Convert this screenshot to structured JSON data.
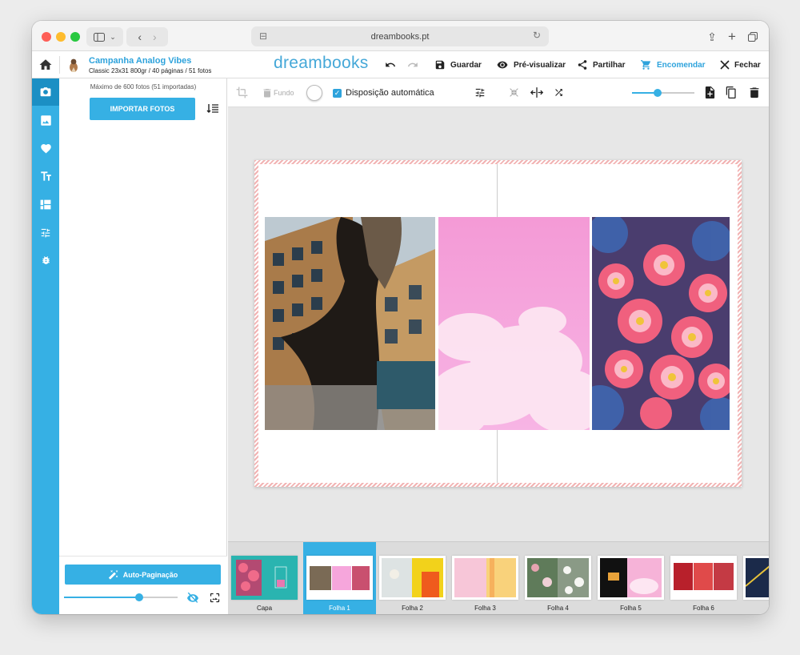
{
  "browser": {
    "url": "dreambooks.pt"
  },
  "header": {
    "project_title": "Campanha Analog Vibes",
    "project_subtitle": "Classic 23x31 800gr / 40 páginas / 51 fotos",
    "logo": "dreambooks",
    "save_label": "Guardar",
    "preview_label": "Pré-visualizar",
    "share_label": "Partilhar",
    "order_label": "Encomendar",
    "close_label": "Fechar"
  },
  "sidebar": {
    "icons": [
      "camera-icon",
      "image-icon",
      "heart-icon",
      "text-icon",
      "layout-icon",
      "sliders-icon",
      "bug-icon"
    ],
    "max_photos_text": "Máximo de 600 fotos (51 importadas)",
    "import_label": "IMPORTAR FOTOS",
    "autopag_label": "Auto-Paginação",
    "thumb_size_value": 0.66
  },
  "toolbar": {
    "background_label": "Fundo",
    "auto_layout_label": "Disposição automática",
    "auto_layout_checked": true,
    "zoom_value": 0.41
  },
  "filmstrip": {
    "sheets": [
      {
        "label": "Capa"
      },
      {
        "label": "Folha 1",
        "active": true
      },
      {
        "label": "Folha 2"
      },
      {
        "label": "Folha 3"
      },
      {
        "label": "Folha 4"
      },
      {
        "label": "Folha 5"
      },
      {
        "label": "Folha 6"
      }
    ]
  },
  "colors": {
    "accent": "#36b0e4",
    "accent_dark": "#1b8fc4",
    "order": "#2ea3dc"
  }
}
